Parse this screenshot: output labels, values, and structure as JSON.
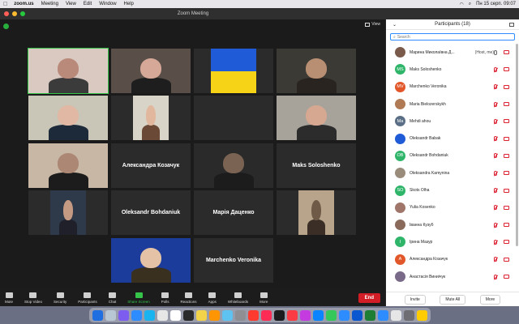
{
  "menubar": {
    "app": "zoom.us",
    "items": [
      "Meeting",
      "View",
      "Edit",
      "Window",
      "Help"
    ],
    "clock": "Пн 15 серп.  09:07"
  },
  "window": {
    "title": "Zoom Meeting",
    "view_label": "View"
  },
  "tiles": [
    {
      "type": "video",
      "name": "",
      "active": true
    },
    {
      "type": "video",
      "name": ""
    },
    {
      "type": "flag",
      "name": ""
    },
    {
      "type": "video",
      "name": ""
    },
    {
      "type": "video",
      "name": ""
    },
    {
      "type": "video",
      "name": ""
    },
    {
      "type": "blank",
      "name": ""
    },
    {
      "type": "video",
      "name": ""
    },
    {
      "type": "video",
      "name": ""
    },
    {
      "type": "name",
      "name": "Александра Козачук"
    },
    {
      "type": "video",
      "name": ""
    },
    {
      "type": "name",
      "name": "Maks Soloshenko"
    },
    {
      "type": "video",
      "name": ""
    },
    {
      "type": "name",
      "name": "Oleksandr Bohdaniuk"
    },
    {
      "type": "name",
      "name": "Марія Даценко"
    },
    {
      "type": "video",
      "name": ""
    },
    {
      "type": "video",
      "name": ""
    },
    {
      "type": "name",
      "name": "Marchenko Veronika"
    }
  ],
  "toolbar": {
    "buttons": [
      "Mute",
      "Stop Video",
      "Security",
      "Participants",
      "Chat",
      "Share Screen",
      "Polls",
      "Reactions",
      "Apps",
      "Whiteboards",
      "More"
    ],
    "participants_count": "18",
    "end_label": "End"
  },
  "panel": {
    "title": "Participants (18)",
    "search_placeholder": "Search",
    "participants": [
      {
        "name": "Марина Миколаївна Д...",
        "suffix": "(Host, me)",
        "initials": "",
        "color": "#7a5a4a",
        "muted": false
      },
      {
        "name": "Maks Soloshenko",
        "suffix": "",
        "initials": "MS",
        "color": "#2fb56a",
        "muted": true
      },
      {
        "name": "Marchenko Veronika",
        "suffix": "",
        "initials": "MV",
        "color": "#e2572a",
        "muted": true
      },
      {
        "name": "Maria Bielozerskykh",
        "suffix": "",
        "initials": "",
        "color": "#b07a55",
        "muted": true
      },
      {
        "name": "Mehdi ahou",
        "suffix": "",
        "initials": "Ma",
        "color": "#5a6f86",
        "muted": true
      },
      {
        "name": "Oleksandr Babak",
        "suffix": "",
        "initials": "",
        "color": "#1f5bd6",
        "muted": true
      },
      {
        "name": "Oleksandr Bohdaniuk",
        "suffix": "",
        "initials": "OB",
        "color": "#2fb56a",
        "muted": true
      },
      {
        "name": "Oleksandra Kamynina",
        "suffix": "",
        "initials": "",
        "color": "#9a8c7a",
        "muted": true
      },
      {
        "name": "Skots Olha",
        "suffix": "",
        "initials": "SO",
        "color": "#2fb56a",
        "muted": true
      },
      {
        "name": "Yulia Kosenko",
        "suffix": "",
        "initials": "",
        "color": "#a0766a",
        "muted": true
      },
      {
        "name": "Іванна Кузуб",
        "suffix": "",
        "initials": "",
        "color": "#8a6a5a",
        "muted": true
      },
      {
        "name": "Ірина Мазур",
        "suffix": "",
        "initials": "І",
        "color": "#2fb56a",
        "muted": true
      },
      {
        "name": "Александра Козачук",
        "suffix": "",
        "initials": "А",
        "color": "#e2572a",
        "muted": true
      },
      {
        "name": "Анастасія Виниічук",
        "suffix": "",
        "initials": "",
        "color": "#7a6a8a",
        "muted": true
      }
    ],
    "invite_label": "Invite",
    "mute_all_label": "Mute All",
    "more_label": "More"
  },
  "dock": {
    "icon_colors": [
      "#1f6fe0",
      "#b9c6d3",
      "#7d5cf0",
      "#2d8cff",
      "#19b4ef",
      "#e6e6e6",
      "#ffffff",
      "#2a2a2a",
      "#f3d34a",
      "#ff9500",
      "#5ec3f0",
      "#8e8e93",
      "#ff3b30",
      "#ff2d55",
      "#1c1c1e",
      "#fc3c44",
      "#c43be0",
      "#0a84ff",
      "#34c759",
      "#2d8cff",
      "#0b57d0",
      "#1e7e34",
      "#2d8cff",
      "#e6e6e6",
      "#6e6e73",
      "#ffcc00"
    ]
  }
}
